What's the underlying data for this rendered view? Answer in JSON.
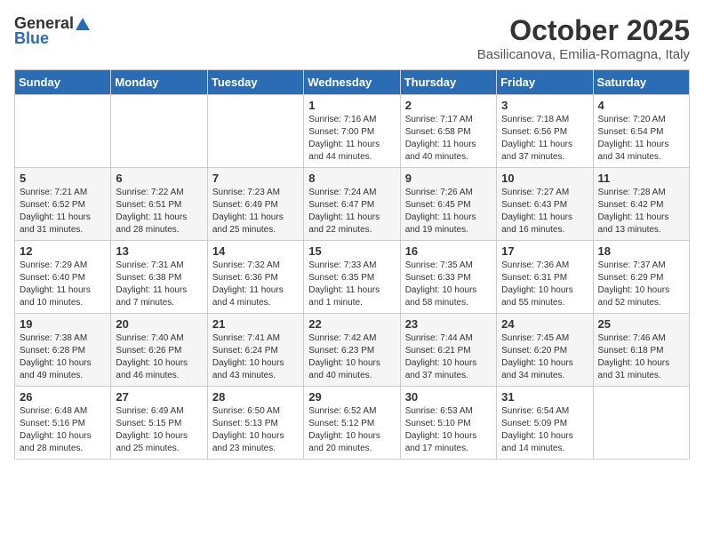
{
  "logo": {
    "general": "General",
    "blue": "Blue"
  },
  "title": "October 2025",
  "location": "Basilicanova, Emilia-Romagna, Italy",
  "weekdays": [
    "Sunday",
    "Monday",
    "Tuesday",
    "Wednesday",
    "Thursday",
    "Friday",
    "Saturday"
  ],
  "weeks": [
    [
      {
        "day": "",
        "info": ""
      },
      {
        "day": "",
        "info": ""
      },
      {
        "day": "",
        "info": ""
      },
      {
        "day": "1",
        "info": "Sunrise: 7:16 AM\nSunset: 7:00 PM\nDaylight: 11 hours and 44 minutes."
      },
      {
        "day": "2",
        "info": "Sunrise: 7:17 AM\nSunset: 6:58 PM\nDaylight: 11 hours and 40 minutes."
      },
      {
        "day": "3",
        "info": "Sunrise: 7:18 AM\nSunset: 6:56 PM\nDaylight: 11 hours and 37 minutes."
      },
      {
        "day": "4",
        "info": "Sunrise: 7:20 AM\nSunset: 6:54 PM\nDaylight: 11 hours and 34 minutes."
      }
    ],
    [
      {
        "day": "5",
        "info": "Sunrise: 7:21 AM\nSunset: 6:52 PM\nDaylight: 11 hours and 31 minutes."
      },
      {
        "day": "6",
        "info": "Sunrise: 7:22 AM\nSunset: 6:51 PM\nDaylight: 11 hours and 28 minutes."
      },
      {
        "day": "7",
        "info": "Sunrise: 7:23 AM\nSunset: 6:49 PM\nDaylight: 11 hours and 25 minutes."
      },
      {
        "day": "8",
        "info": "Sunrise: 7:24 AM\nSunset: 6:47 PM\nDaylight: 11 hours and 22 minutes."
      },
      {
        "day": "9",
        "info": "Sunrise: 7:26 AM\nSunset: 6:45 PM\nDaylight: 11 hours and 19 minutes."
      },
      {
        "day": "10",
        "info": "Sunrise: 7:27 AM\nSunset: 6:43 PM\nDaylight: 11 hours and 16 minutes."
      },
      {
        "day": "11",
        "info": "Sunrise: 7:28 AM\nSunset: 6:42 PM\nDaylight: 11 hours and 13 minutes."
      }
    ],
    [
      {
        "day": "12",
        "info": "Sunrise: 7:29 AM\nSunset: 6:40 PM\nDaylight: 11 hours and 10 minutes."
      },
      {
        "day": "13",
        "info": "Sunrise: 7:31 AM\nSunset: 6:38 PM\nDaylight: 11 hours and 7 minutes."
      },
      {
        "day": "14",
        "info": "Sunrise: 7:32 AM\nSunset: 6:36 PM\nDaylight: 11 hours and 4 minutes."
      },
      {
        "day": "15",
        "info": "Sunrise: 7:33 AM\nSunset: 6:35 PM\nDaylight: 11 hours and 1 minute."
      },
      {
        "day": "16",
        "info": "Sunrise: 7:35 AM\nSunset: 6:33 PM\nDaylight: 10 hours and 58 minutes."
      },
      {
        "day": "17",
        "info": "Sunrise: 7:36 AM\nSunset: 6:31 PM\nDaylight: 10 hours and 55 minutes."
      },
      {
        "day": "18",
        "info": "Sunrise: 7:37 AM\nSunset: 6:29 PM\nDaylight: 10 hours and 52 minutes."
      }
    ],
    [
      {
        "day": "19",
        "info": "Sunrise: 7:38 AM\nSunset: 6:28 PM\nDaylight: 10 hours and 49 minutes."
      },
      {
        "day": "20",
        "info": "Sunrise: 7:40 AM\nSunset: 6:26 PM\nDaylight: 10 hours and 46 minutes."
      },
      {
        "day": "21",
        "info": "Sunrise: 7:41 AM\nSunset: 6:24 PM\nDaylight: 10 hours and 43 minutes."
      },
      {
        "day": "22",
        "info": "Sunrise: 7:42 AM\nSunset: 6:23 PM\nDaylight: 10 hours and 40 minutes."
      },
      {
        "day": "23",
        "info": "Sunrise: 7:44 AM\nSunset: 6:21 PM\nDaylight: 10 hours and 37 minutes."
      },
      {
        "day": "24",
        "info": "Sunrise: 7:45 AM\nSunset: 6:20 PM\nDaylight: 10 hours and 34 minutes."
      },
      {
        "day": "25",
        "info": "Sunrise: 7:46 AM\nSunset: 6:18 PM\nDaylight: 10 hours and 31 minutes."
      }
    ],
    [
      {
        "day": "26",
        "info": "Sunrise: 6:48 AM\nSunset: 5:16 PM\nDaylight: 10 hours and 28 minutes."
      },
      {
        "day": "27",
        "info": "Sunrise: 6:49 AM\nSunset: 5:15 PM\nDaylight: 10 hours and 25 minutes."
      },
      {
        "day": "28",
        "info": "Sunrise: 6:50 AM\nSunset: 5:13 PM\nDaylight: 10 hours and 23 minutes."
      },
      {
        "day": "29",
        "info": "Sunrise: 6:52 AM\nSunset: 5:12 PM\nDaylight: 10 hours and 20 minutes."
      },
      {
        "day": "30",
        "info": "Sunrise: 6:53 AM\nSunset: 5:10 PM\nDaylight: 10 hours and 17 minutes."
      },
      {
        "day": "31",
        "info": "Sunrise: 6:54 AM\nSunset: 5:09 PM\nDaylight: 10 hours and 14 minutes."
      },
      {
        "day": "",
        "info": ""
      }
    ]
  ]
}
